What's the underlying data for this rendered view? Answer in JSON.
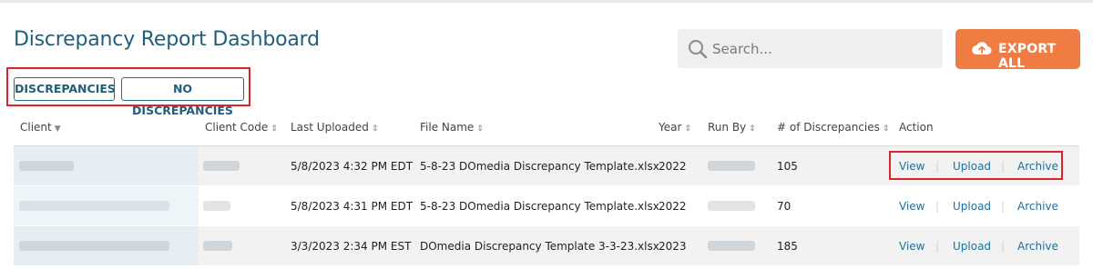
{
  "header": {
    "title": "Discrepancy Report Dashboard",
    "search_placeholder": "Search...",
    "export_label": "EXPORT ALL"
  },
  "filters": [
    {
      "label": "DISCREPANCIES"
    },
    {
      "label": "NO DISCREPANCIES"
    }
  ],
  "table": {
    "columns": [
      "Client",
      "Client Code",
      "Last Uploaded",
      "File Name",
      "Year",
      "Run By",
      "# of Discrepancies",
      "Action"
    ],
    "rows": [
      {
        "last_uploaded": "5/8/2023 4:32 PM EDT",
        "file_name": "5-8-23 DOmedia Discrepancy Template.xlsx",
        "year": "2022",
        "discrepancies": "105"
      },
      {
        "last_uploaded": "5/8/2023 4:31 PM EDT",
        "file_name": "5-8-23 DOmedia Discrepancy Template.xlsx",
        "year": "2022",
        "discrepancies": "70"
      },
      {
        "last_uploaded": "3/3/2023 2:34 PM EST",
        "file_name": "DOmedia Discrepancy Template 3-3-23.xlsx",
        "year": "2023",
        "discrepancies": "185"
      }
    ],
    "actions": {
      "view": "View",
      "upload": "Upload",
      "archive": "Archive"
    }
  },
  "colors": {
    "accent": "#1f5f7a",
    "export": "#ef7d43",
    "highlight": "#d9252b"
  },
  "icons": {
    "search": "search-icon",
    "export": "cloud-upload-icon",
    "sort": "sort-icon"
  }
}
